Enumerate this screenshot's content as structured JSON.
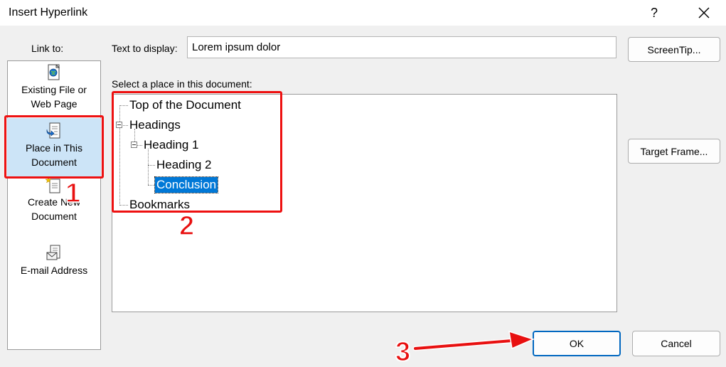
{
  "window": {
    "title": "Insert Hyperlink",
    "help_label": "?",
    "close_icon": "close-icon"
  },
  "link_to": {
    "label": "Link to:",
    "items": [
      {
        "label": "Existing File or\nWeb Page",
        "icon": "web-page-icon"
      },
      {
        "label": "Place in This\nDocument",
        "icon": "document-place-icon",
        "selected": true
      },
      {
        "label": "Create New\nDocument",
        "icon": "new-document-icon"
      },
      {
        "label": "E-mail Address",
        "icon": "email-icon"
      }
    ]
  },
  "text_to_display": {
    "label": "Text to display:",
    "value": "Lorem ipsum dolor"
  },
  "place_section": {
    "label": "Select a place in this document:",
    "tree": [
      {
        "label": "Top of the Document",
        "level": 0
      },
      {
        "label": "Headings",
        "level": 0,
        "expanded": true
      },
      {
        "label": "Heading 1",
        "level": 1,
        "expanded": true
      },
      {
        "label": "Heading 2",
        "level": 2
      },
      {
        "label": "Conclusion",
        "level": 2,
        "selected": true
      },
      {
        "label": "Bookmarks",
        "level": 0
      }
    ]
  },
  "buttons": {
    "screentip": "ScreenTip...",
    "target_frame": "Target Frame...",
    "ok": "OK",
    "cancel": "Cancel"
  },
  "annotations": {
    "step1": "1",
    "step2": "2",
    "step3": "3",
    "color": "#e81010"
  },
  "colors": {
    "selection": "#0078d7",
    "sidebar_selected": "#cce4f7",
    "ok_border": "#0067c0"
  }
}
